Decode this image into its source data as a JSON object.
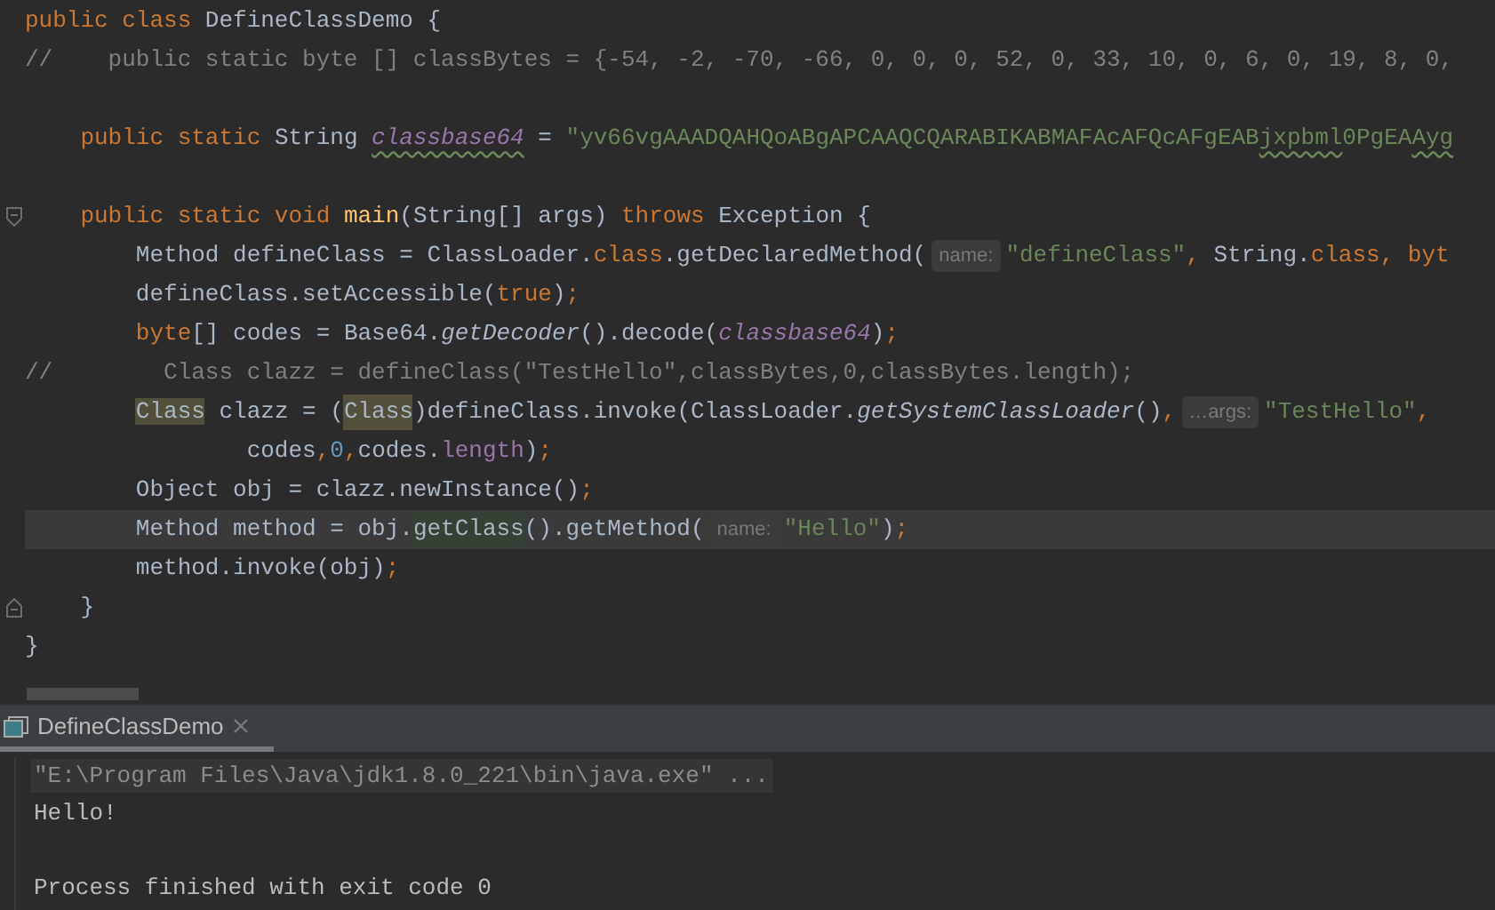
{
  "editor": {
    "lines": [
      {
        "kind": "code",
        "current": false,
        "segments": [
          {
            "kind": "kw",
            "text": "public class "
          },
          {
            "kind": "plain",
            "text": "DefineClassDemo {"
          }
        ]
      },
      {
        "kind": "code",
        "current": false,
        "segments": [
          {
            "kind": "comment",
            "text": "//    public static byte [] classBytes = {-54, -2, -70, -66, 0, 0, 0, 52, 0, 33, 10, 0, 6, 0, 19, 8, 0,"
          }
        ]
      },
      {
        "kind": "blank",
        "current": false
      },
      {
        "kind": "code",
        "current": false,
        "segments": [
          {
            "kind": "kw",
            "text": "    public static "
          },
          {
            "kind": "plain",
            "text": "String "
          },
          {
            "kind": "static_field",
            "text": "classbase64",
            "typo": true
          },
          {
            "kind": "plain",
            "text": " = "
          },
          {
            "kind": "str",
            "text": "\"yv66vgAAADQAHQoABgAPCAAQCQARABIKABMAFAcAFQcAFgEAB"
          },
          {
            "kind": "str",
            "text": "jxpbml",
            "typo": true
          },
          {
            "kind": "str",
            "text": "0PgEA"
          },
          {
            "kind": "str",
            "text": "Ayg",
            "typo": true
          }
        ]
      },
      {
        "kind": "blank",
        "current": false
      },
      {
        "kind": "code",
        "current": false,
        "fold_start": true,
        "segments": [
          {
            "kind": "kw",
            "text": "    public static void "
          },
          {
            "kind": "method_decl",
            "text": "main"
          },
          {
            "kind": "plain",
            "text": "(String[] args) "
          },
          {
            "kind": "kw",
            "text": "throws "
          },
          {
            "kind": "plain",
            "text": "Exception {"
          }
        ]
      },
      {
        "kind": "code",
        "current": false,
        "segments": [
          {
            "kind": "plain",
            "text": "        Method defineClass = ClassLoader."
          },
          {
            "kind": "kw",
            "text": "class"
          },
          {
            "kind": "plain",
            "text": ".getDeclaredMethod("
          },
          {
            "kind": "hint",
            "text": "name:"
          },
          {
            "kind": "str",
            "text": "\"defineClass\""
          },
          {
            "kind": "kw",
            "text": ", "
          },
          {
            "kind": "plain",
            "text": "String."
          },
          {
            "kind": "kw",
            "text": "class, byt"
          }
        ]
      },
      {
        "kind": "code",
        "current": false,
        "segments": [
          {
            "kind": "plain",
            "text": "        defineClass.setAccessible("
          },
          {
            "kind": "kw",
            "text": "true"
          },
          {
            "kind": "plain",
            "text": ")"
          },
          {
            "kind": "kw",
            "text": ";"
          }
        ]
      },
      {
        "kind": "code",
        "current": false,
        "segments": [
          {
            "kind": "kw",
            "text": "        byte"
          },
          {
            "kind": "plain",
            "text": "[] codes = Base64."
          },
          {
            "kind": "static_call",
            "text": "getDecoder"
          },
          {
            "kind": "plain",
            "text": "().decode("
          },
          {
            "kind": "static_field",
            "text": "classbase64"
          },
          {
            "kind": "plain",
            "text": ")"
          },
          {
            "kind": "kw",
            "text": ";"
          }
        ]
      },
      {
        "kind": "code",
        "current": false,
        "segments": [
          {
            "kind": "comment",
            "text": "//        Class clazz = defineClass(\"TestHello\",classBytes,0,classBytes.length);"
          }
        ]
      },
      {
        "kind": "code",
        "current": false,
        "segments": [
          {
            "kind": "usage",
            "text": "        Class"
          },
          {
            "kind": "plain",
            "text": " clazz = ("
          },
          {
            "kind": "usage",
            "text": "Class"
          },
          {
            "kind": "plain",
            "text": ")defineClass.invoke(ClassLoader."
          },
          {
            "kind": "static_call",
            "text": "getSystemClassLoader"
          },
          {
            "kind": "plain",
            "text": "()"
          },
          {
            "kind": "kw",
            "text": ","
          },
          {
            "kind": "hint",
            "text": "…args:"
          },
          {
            "kind": "str",
            "text": "\"TestHello\""
          },
          {
            "kind": "kw",
            "text": ","
          }
        ]
      },
      {
        "kind": "code",
        "current": false,
        "segments": [
          {
            "kind": "plain",
            "text": "                codes"
          },
          {
            "kind": "kw",
            "text": ","
          },
          {
            "kind": "num",
            "text": "0"
          },
          {
            "kind": "kw",
            "text": ","
          },
          {
            "kind": "plain",
            "text": "codes."
          },
          {
            "kind": "field",
            "text": "length"
          },
          {
            "kind": "plain",
            "text": ")"
          },
          {
            "kind": "kw",
            "text": ";"
          }
        ]
      },
      {
        "kind": "code",
        "current": false,
        "segments": [
          {
            "kind": "plain",
            "text": "        Object obj = clazz.newInstance()"
          },
          {
            "kind": "kw",
            "text": ";"
          }
        ]
      },
      {
        "kind": "code",
        "current": true,
        "segments": [
          {
            "kind": "plain",
            "text": "        Method method = obj."
          },
          {
            "kind": "match",
            "text": "getClass"
          },
          {
            "kind": "plain",
            "text": "().getMethod("
          },
          {
            "kind": "hint",
            "text": "name:"
          },
          {
            "kind": "str",
            "text": "\"Hello\""
          },
          {
            "kind": "plain",
            "text": ")"
          },
          {
            "kind": "kw",
            "text": ";"
          }
        ]
      },
      {
        "kind": "code",
        "current": false,
        "segments": [
          {
            "kind": "plain",
            "text": "        method.invoke(obj)"
          },
          {
            "kind": "kw",
            "text": ";"
          }
        ]
      },
      {
        "kind": "code",
        "current": false,
        "fold_end": true,
        "segments": [
          {
            "kind": "plain",
            "text": "    }"
          }
        ]
      },
      {
        "kind": "code",
        "current": false,
        "segments": [
          {
            "kind": "plain",
            "text": "}"
          }
        ]
      }
    ]
  },
  "run_panel": {
    "tabs": [
      {
        "title": "DefineClassDemo",
        "selected": true
      }
    ],
    "output": [
      {
        "kind": "command",
        "text": "\"E:\\Program Files\\Java\\jdk1.8.0_221\\bin\\java.exe\" ..."
      },
      {
        "kind": "stdout",
        "text": "Hello!"
      },
      {
        "kind": "blank"
      },
      {
        "kind": "system",
        "text": "Process finished with exit code 0"
      }
    ]
  }
}
